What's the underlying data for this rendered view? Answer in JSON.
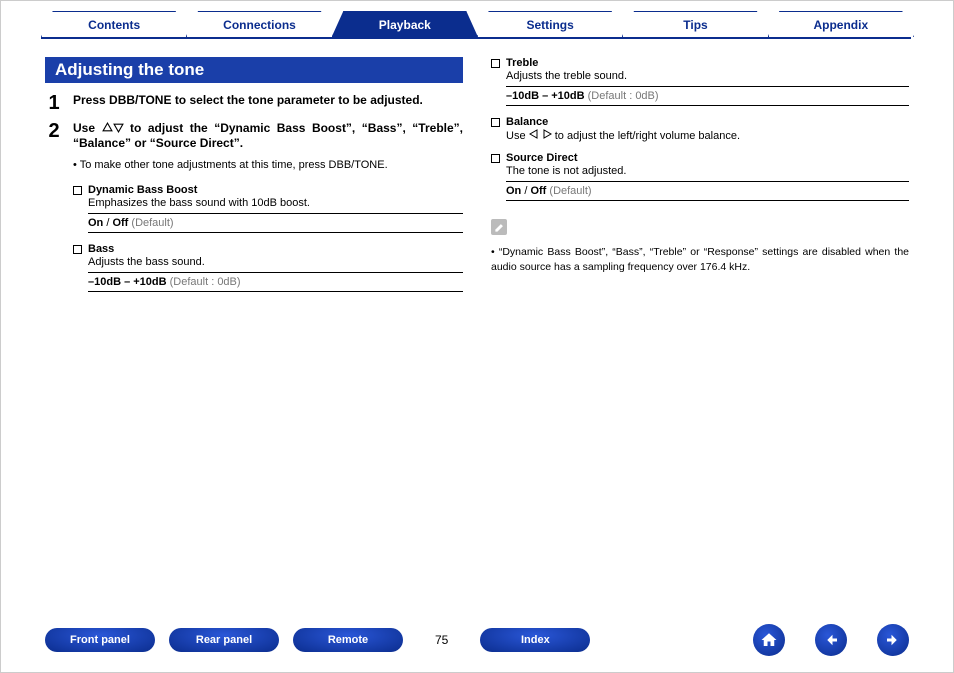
{
  "tabs": {
    "contents": "Contents",
    "connections": "Connections",
    "playback": "Playback",
    "settings": "Settings",
    "tips": "Tips",
    "appendix": "Appendix"
  },
  "section_title": "Adjusting the tone",
  "steps": {
    "s1": {
      "num": "1",
      "text": "Press DBB/TONE to select the tone parameter to be adjusted."
    },
    "s2": {
      "num": "2",
      "pre": "Use ",
      "post": " to adjust the “Dynamic Bass Boost”, “Bass”, “Treble”, “Balance” or “Source Direct”."
    }
  },
  "sub_bullet": "To make other tone adjustments at this time, press DBB/TONE.",
  "items": {
    "dbb": {
      "name": "Dynamic Bass Boost",
      "desc": "Emphasizes the bass sound with 10dB boost.",
      "val_b1": "On",
      "slash": " / ",
      "val_b2": "Off",
      "def": " (Default)"
    },
    "bass": {
      "name": "Bass",
      "desc": "Adjusts the bass sound.",
      "val_b": "–10dB – +10dB",
      "def": " (Default : 0dB)"
    },
    "treble": {
      "name": "Treble",
      "desc": "Adjusts the treble sound.",
      "val_b": "–10dB – +10dB",
      "def": " (Default : 0dB)"
    },
    "balance": {
      "name": "Balance",
      "desc_pre": "Use ",
      "desc_post": " to  adjust the left/right volume balance."
    },
    "sdirect": {
      "name": "Source Direct",
      "desc": "The tone is not adjusted.",
      "val_b1": "On",
      "slash": " / ",
      "val_b2": "Off",
      "def": " (Default)"
    }
  },
  "note": "“Dynamic Bass Boost”, “Bass”, “Treble” or “Response” settings are disabled when the audio source has a sampling frequency over 176.4 kHz.",
  "footer": {
    "front_panel": "Front panel",
    "rear_panel": "Rear panel",
    "remote": "Remote",
    "page": "75",
    "index": "Index"
  }
}
